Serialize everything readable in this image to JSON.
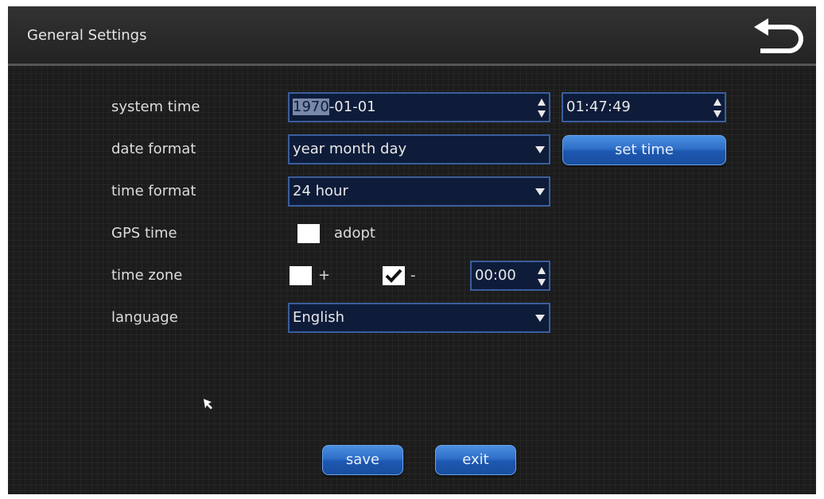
{
  "window": {
    "title": "General Settings"
  },
  "labels": {
    "system_time": "system time",
    "date_format": "date format",
    "time_format": "time format",
    "gps_time": "GPS time",
    "time_zone": "time zone",
    "language": "language"
  },
  "system_time": {
    "date_selected": "1970",
    "date_rest": "-01-01",
    "time": "01:47:49"
  },
  "date_format": {
    "value": "year month day"
  },
  "time_format": {
    "value": "24 hour"
  },
  "gps_time": {
    "adopt_label": "adopt",
    "adopt_checked": false
  },
  "time_zone": {
    "plus_label": "+",
    "plus_checked": false,
    "minus_label": "-",
    "minus_checked": true,
    "offset": "00:00"
  },
  "language": {
    "value": "English"
  },
  "buttons": {
    "set_time": "set time",
    "save": "save",
    "exit": "exit"
  },
  "icons": {
    "back": "back-arrow-icon",
    "spin": "spinner-arrows-icon",
    "dropdown": "dropdown-arrow-icon",
    "check": "checkmark-icon",
    "cursor": "mouse-pointer-icon"
  },
  "colors": {
    "field_bg": "#0e1c3a",
    "field_border": "#3a5e9c",
    "button_blue": "#2f6fc8",
    "screen_bg": "#1c1c1c"
  }
}
